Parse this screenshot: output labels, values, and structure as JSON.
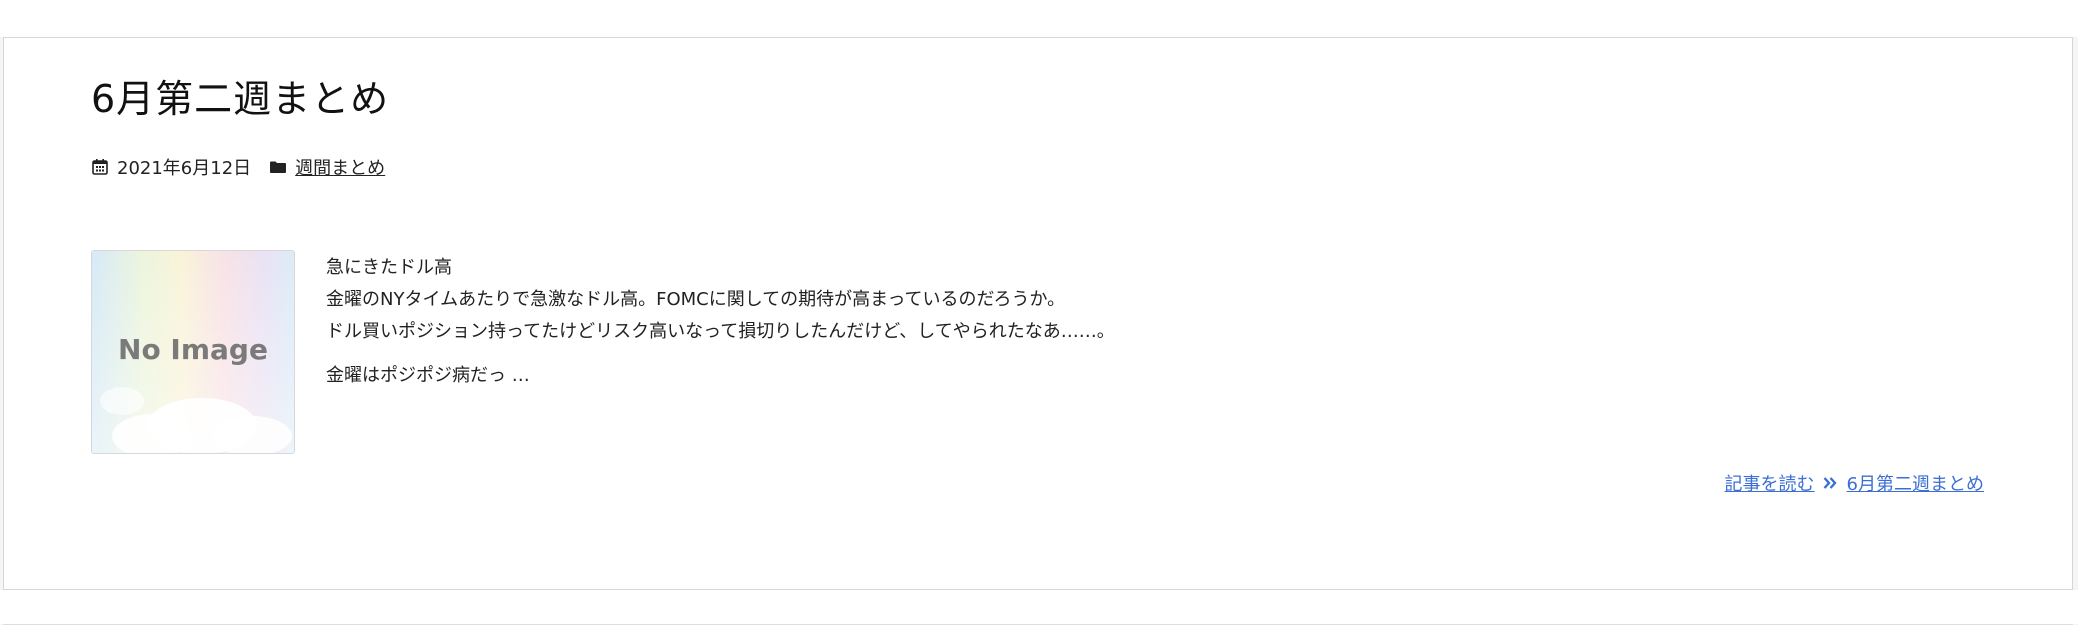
{
  "post": {
    "title": "6月第二週まとめ",
    "date": "2021年6月12日",
    "category": "週間まとめ",
    "thumbnail_text": "No Image",
    "excerpt": {
      "line1": "急にきたドル高",
      "line2": "金曜のNYタイムあたりで急激なドル高。FOMCに関しての期待が高まっているのだろうか。",
      "line3": "ドル買いポジション持ってたけどリスク高いなって損切りしたんだけど、してやられたなあ‥‥‥。",
      "line4": "金曜はポジポジ病だっ …"
    },
    "read_more_label": "記事を読む",
    "read_more_title": "6月第二週まとめ"
  },
  "icons": {
    "date": "calendar-icon",
    "category": "folder-icon",
    "read_more": "double-chevron-right-icon"
  },
  "colors": {
    "link": "#3b6fd4",
    "text": "#222222",
    "border": "#d6d6d6"
  }
}
